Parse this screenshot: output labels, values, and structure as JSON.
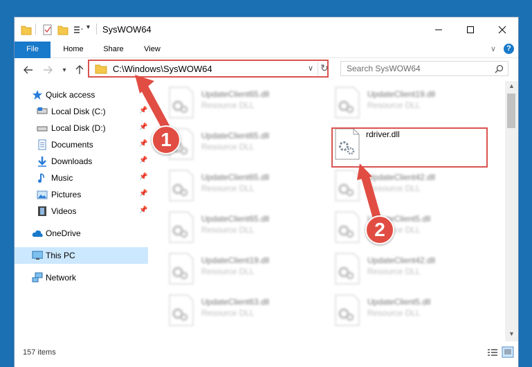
{
  "window": {
    "title": "SysWOW64"
  },
  "ribbon": {
    "tabs": [
      {
        "label": "File"
      },
      {
        "label": "Home"
      },
      {
        "label": "Share"
      },
      {
        "label": "View"
      }
    ]
  },
  "address": {
    "path": "C:\\Windows\\SysWOW64"
  },
  "search": {
    "placeholder": "Search SysWOW64"
  },
  "nav": {
    "items": [
      {
        "label": "Quick access"
      },
      {
        "label": "Local Disk (C:)"
      },
      {
        "label": "Local Disk (D:)"
      },
      {
        "label": "Documents"
      },
      {
        "label": "Downloads"
      },
      {
        "label": "Music"
      },
      {
        "label": "Pictures"
      },
      {
        "label": "Videos"
      },
      {
        "label": "OneDrive"
      },
      {
        "label": "This PC"
      },
      {
        "label": "Network"
      }
    ]
  },
  "files": [
    {
      "name": "UpdateClient65.dll",
      "type": "Resource DLL"
    },
    {
      "name": "UpdateClient19.dll",
      "type": "Resource DLL"
    },
    {
      "name": "UpdateClient65.dll",
      "type": "Resource DLL"
    },
    {
      "name": "rdriver.dll",
      "type": ""
    },
    {
      "name": "UpdateClient65.dll",
      "type": "Resource DLL"
    },
    {
      "name": "UpdateClient42.dll",
      "type": "Resource DLL"
    },
    {
      "name": "UpdateClient65.dll",
      "type": "Resource DLL"
    },
    {
      "name": "UpdateClient5.dll",
      "type": "Resource DLL"
    },
    {
      "name": "UpdateClient19.dll",
      "type": "Resource DLL"
    },
    {
      "name": "UpdateClient42.dll",
      "type": "Resource DLL"
    },
    {
      "name": "UpdateClient63.dll",
      "type": "Resource DLL"
    },
    {
      "name": "UpdateClient5.dll",
      "type": "Resource DLL"
    }
  ],
  "callouts": {
    "one": "1",
    "two": "2"
  },
  "status": {
    "count": "157 items"
  },
  "colors": {
    "accent": "#1979ca",
    "highlight": "#d9534f",
    "selected_nav": "#cce8ff"
  }
}
